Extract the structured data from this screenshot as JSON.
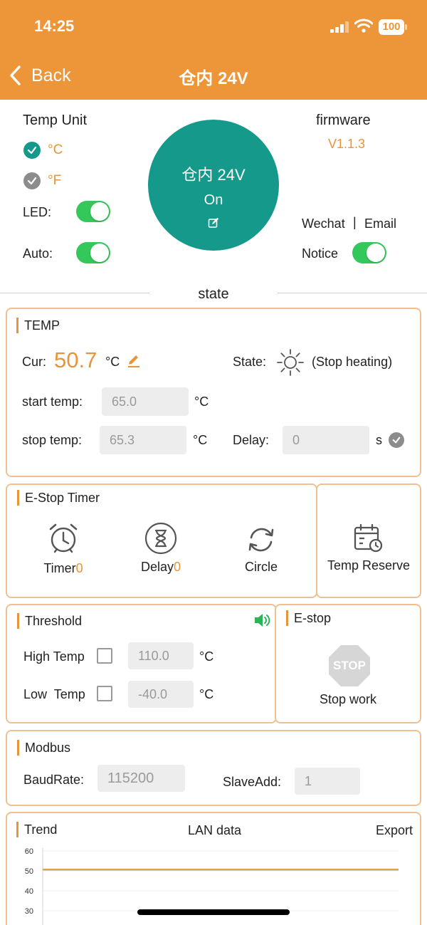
{
  "status_bar": {
    "time": "14:25",
    "battery": "100"
  },
  "nav": {
    "back_label": "Back",
    "title": "仓内 24V"
  },
  "settings": {
    "temp_unit_label": "Temp Unit",
    "unit_c": "°C",
    "unit_f": "°F",
    "led_label": "LED:",
    "auto_label": "Auto:",
    "firmware_label": "firmware",
    "firmware_version": "V1.1.3",
    "wechat_label": "Wechat",
    "separator": "|",
    "email_label": "Email",
    "notice_label": "Notice"
  },
  "device": {
    "name": "仓内 24V",
    "status": "On"
  },
  "state_label": "state",
  "temp": {
    "title": "TEMP",
    "cur_label": "Cur:",
    "cur_value": "50.7",
    "unit": "°C",
    "state_label": "State:",
    "state_value": "(Stop heating)",
    "start_label": "start temp:",
    "start_value": "65.0",
    "stop_label": "stop temp:",
    "stop_value": "65.3",
    "delay_label": "Delay:",
    "delay_value": "0",
    "seconds_unit": "s"
  },
  "estop_timer": {
    "title": "E-Stop Timer",
    "timer_label": "Timer",
    "timer_count": "0",
    "delay_label": "Delay",
    "delay_count": "0",
    "circle_label": "Circle",
    "reserve_label": "Temp Reserve"
  },
  "threshold": {
    "title": "Threshold",
    "high_label": "High Temp",
    "high_value": "110.0",
    "low_label": "Low  Temp",
    "low_value": "-40.0",
    "unit": "°C"
  },
  "estop": {
    "title": "E-stop",
    "stop_sign": "STOP",
    "stop_label": "Stop work"
  },
  "modbus": {
    "title": "Modbus",
    "baud_label": "BaudRate:",
    "baud_value": "115200",
    "slave_label": "SlaveAdd:",
    "slave_value": "1"
  },
  "trend": {
    "title": "Trend",
    "lan_label": "LAN data",
    "export_label": "Export"
  },
  "colors": {
    "accent": "#ec9539",
    "teal": "#14998a",
    "toggle_on": "#34c759"
  },
  "chart_data": {
    "type": "line",
    "title": "",
    "xlabel": "",
    "ylabel": "",
    "ylim": [
      30,
      60
    ],
    "yticks": [
      "60",
      "50",
      "40",
      "30"
    ],
    "series": [
      {
        "values": [
          50.8,
          50.8,
          50.8,
          50.8,
          50.8
        ],
        "color": "#e8943a"
      },
      {
        "values": [
          50.4,
          50.4,
          50.4,
          50.4,
          50.4
        ],
        "color": "#b5b5b5"
      }
    ]
  }
}
